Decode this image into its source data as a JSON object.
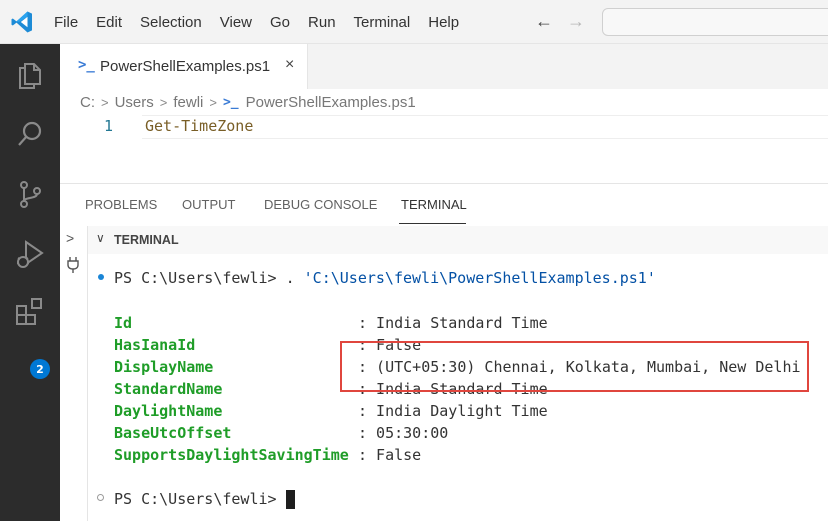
{
  "menu": [
    "File",
    "Edit",
    "Selection",
    "View",
    "Go",
    "Run",
    "Terminal",
    "Help"
  ],
  "editor": {
    "tab_icon": ">_",
    "tab_label": "PowerShellExamples.ps1",
    "tab_close": "×",
    "breadcrumb": [
      "C:",
      "Users",
      "fewli",
      "PowerShellExamples.ps1"
    ],
    "line_number": "1",
    "code": "Get-TimeZone"
  },
  "activity_badge": "2",
  "panel": {
    "tabs": [
      "PROBLEMS",
      "OUTPUT",
      "DEBUG CONSOLE",
      "TERMINAL"
    ],
    "active_tab": "TERMINAL",
    "terminal_title": "TERMINAL"
  },
  "terminal": {
    "prompt_path": "PS C:\\Users\\fewli> ",
    "command_prefix": ". ",
    "command_string": "'C:\\Users\\fewli\\PowerShellExamples.ps1'",
    "properties": [
      {
        "name": "Id",
        "value": ": India Standard Time"
      },
      {
        "name": "HasIanaId",
        "value": ": False"
      },
      {
        "name": "DisplayName",
        "value": ": (UTC+05:30) Chennai, Kolkata, Mumbai, New Delhi"
      },
      {
        "name": "StandardName",
        "value": ": India Standard Time"
      },
      {
        "name": "DaylightName",
        "value": ": India Daylight Time"
      },
      {
        "name": "BaseUtcOffset",
        "value": ": 05:30:00"
      },
      {
        "name": "SupportsDaylightSavingTime",
        "value": ": False"
      }
    ],
    "final_prompt": "PS C:\\Users\\fewli> "
  },
  "colors": {
    "activity_bar": "#2c2c2c",
    "accent": "#0078d4",
    "property_name": "#1f9d28",
    "string": "#0451a5",
    "highlight_box": "#e0463e"
  }
}
